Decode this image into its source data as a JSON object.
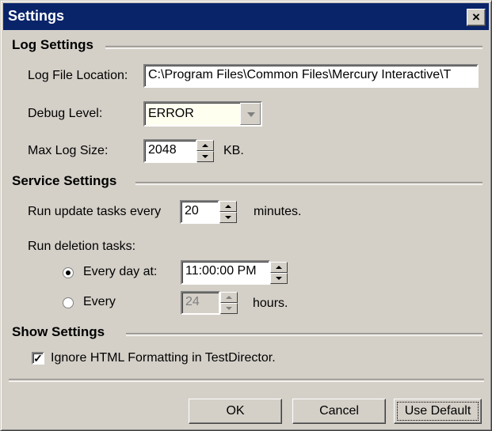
{
  "window": {
    "title": "Settings",
    "close_glyph": "×"
  },
  "log_settings": {
    "title": "Log Settings",
    "location_label": "Log File Location:",
    "location_value": "C:\\Program Files\\Common Files\\Mercury Interactive\\T",
    "debug_label": "Debug Level:",
    "debug_value": "ERROR",
    "max_size_label": "Max Log Size:",
    "max_size_value": "2048",
    "max_size_unit": "KB."
  },
  "service_settings": {
    "title": "Service Settings",
    "update_prefix": "Run update tasks every",
    "update_value": "20",
    "update_unit": "minutes.",
    "deletion_label": "Run deletion tasks:",
    "every_day_label": "Every day at:",
    "every_day_time": "11:00:00 PM",
    "every_label": "Every",
    "every_value": "24",
    "every_unit": "hours.",
    "selected_option": "every-day"
  },
  "show_settings": {
    "title": "Show Settings",
    "ignore_html_label": "Ignore HTML Formatting in TestDirector.",
    "ignore_html_checked": true,
    "check_glyph": "✓"
  },
  "buttons": {
    "ok": "OK",
    "cancel": "Cancel",
    "use_default": "Use Default"
  },
  "colors": {
    "title_bar": "#0a246a",
    "dialog_bg": "#d4d0c8"
  }
}
